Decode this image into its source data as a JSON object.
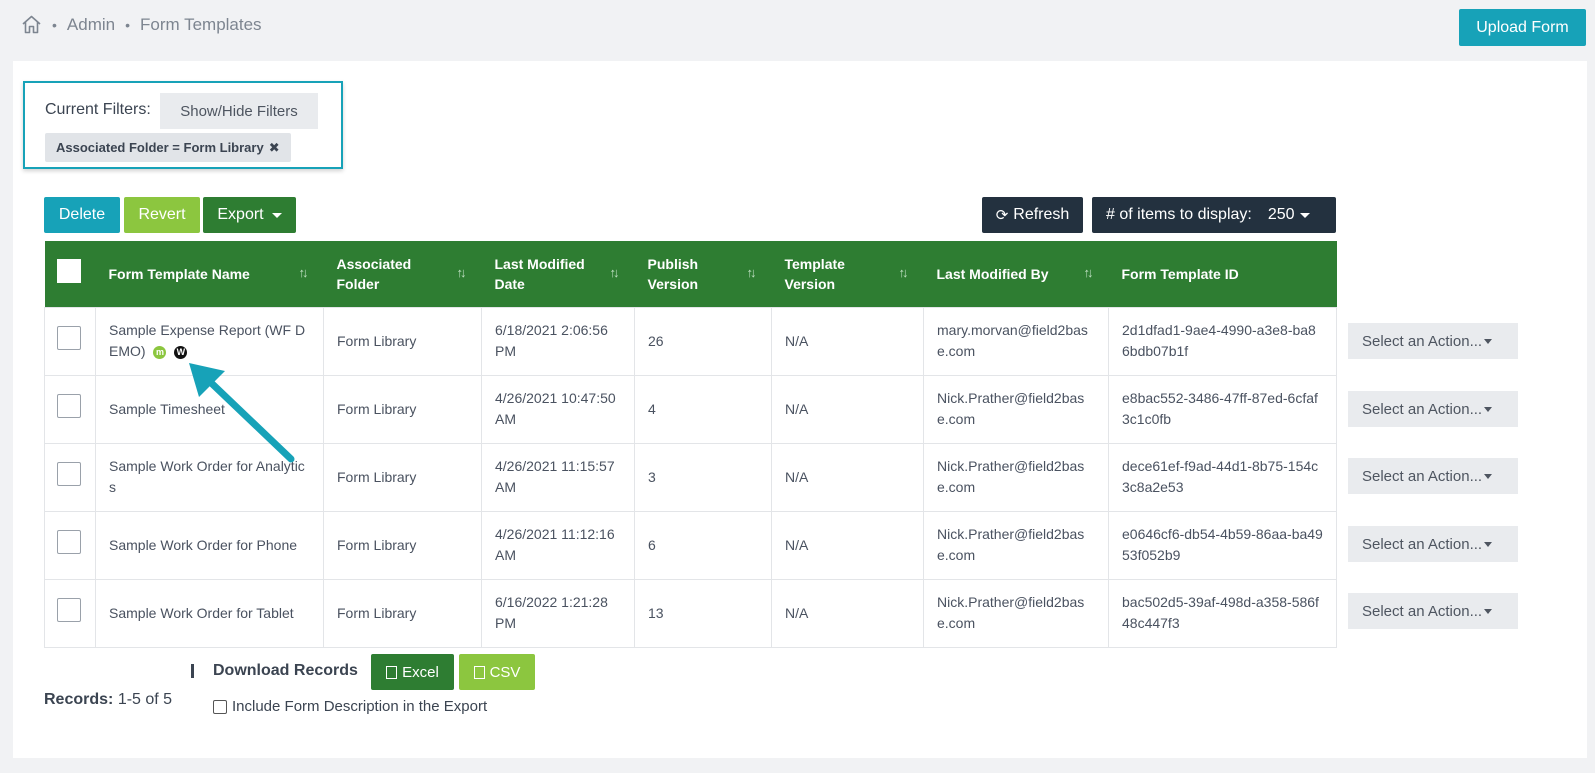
{
  "breadcrumb": {
    "items": [
      "Admin",
      "Form Templates"
    ]
  },
  "header": {
    "upload_label": "Upload Form"
  },
  "filters": {
    "label": "Current Filters:",
    "toggle_label": "Show/Hide Filters",
    "chip_label": "Associated Folder = Form Library",
    "chip_remove": "✖"
  },
  "toolbar": {
    "delete_label": "Delete",
    "revert_label": "Revert",
    "export_label": "Export",
    "refresh_label": "Refresh",
    "items_label": "# of items to display:",
    "items_value": "250"
  },
  "table": {
    "headers": [
      "Form Template Name",
      "Associated Folder",
      "Last Modified Date",
      "Publish Version",
      "Template Version",
      "Last Modified By",
      "Form Template ID"
    ],
    "rows": [
      {
        "name": "Sample Expense Report (WF DEMO)",
        "folder": "Form Library",
        "modified": "6/18/2021 2:06:56 PM",
        "publish": "26",
        "template": "N/A",
        "by": "mary.morvan@field2base.com",
        "id": "2d1dfad1-9ae4-4990-a3e8-ba86bdb07b1f",
        "badges": [
          "m",
          "W"
        ]
      },
      {
        "name": "Sample Timesheet",
        "folder": "Form Library",
        "modified": "4/26/2021 10:47:50 AM",
        "publish": "4",
        "template": "N/A",
        "by": "Nick.Prather@field2base.com",
        "id": "e8bac552-3486-47ff-87ed-6cfaf3c1c0fb"
      },
      {
        "name": "Sample Work Order for Analytics",
        "folder": "Form Library",
        "modified": "4/26/2021 11:15:57 AM",
        "publish": "3",
        "template": "N/A",
        "by": "Nick.Prather@field2base.com",
        "id": "dece61ef-f9ad-44d1-8b75-154c3c8a2e53"
      },
      {
        "name": "Sample Work Order for Phone",
        "folder": "Form Library",
        "modified": "4/26/2021 11:12:16 AM",
        "publish": "6",
        "template": "N/A",
        "by": "Nick.Prather@field2base.com",
        "id": "e0646cf6-db54-4b59-86aa-ba4953f052b9"
      },
      {
        "name": "Sample Work Order for Tablet",
        "folder": "Form Library",
        "modified": "6/16/2022 1:21:28 PM",
        "publish": "13",
        "template": "N/A",
        "by": "Nick.Prather@field2base.com",
        "id": "bac502d5-39af-498d-a358-586f48c447f3"
      }
    ],
    "action_label": "Select an Action..."
  },
  "footer": {
    "records_label": "Records:",
    "records_value": "1-5 of 5",
    "download_label": "Download Records",
    "excel_label": "Excel",
    "csv_label": "CSV",
    "include_label": "Include Form Description in the Export"
  },
  "colors": {
    "teal": "#17a2b8",
    "green": "#2e7d32",
    "lime": "#8cc63f",
    "navy": "#23313f"
  }
}
